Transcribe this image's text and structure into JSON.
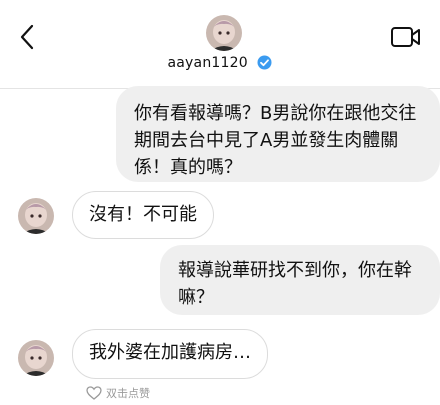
{
  "header": {
    "username": "aayan1120"
  },
  "messages": [
    {
      "text": "你有看報導嗎？B男說你在跟他交往期間去台中見了A男並發生肉體關係！真的嗎？"
    },
    {
      "text": "沒有！不可能"
    },
    {
      "text": "報導說華研找不到你，你在幹嘛？"
    },
    {
      "text": "我外婆在加護病房…"
    }
  ],
  "reaction": {
    "label": "双击点赞"
  },
  "icons": {
    "back": "chevron-left-icon",
    "video": "video-call-icon",
    "verified": "verified-badge-icon",
    "like": "heart-outline-icon"
  },
  "colors": {
    "verified_blue": "#3b9bf0",
    "bubble_gray": "#efefef"
  }
}
